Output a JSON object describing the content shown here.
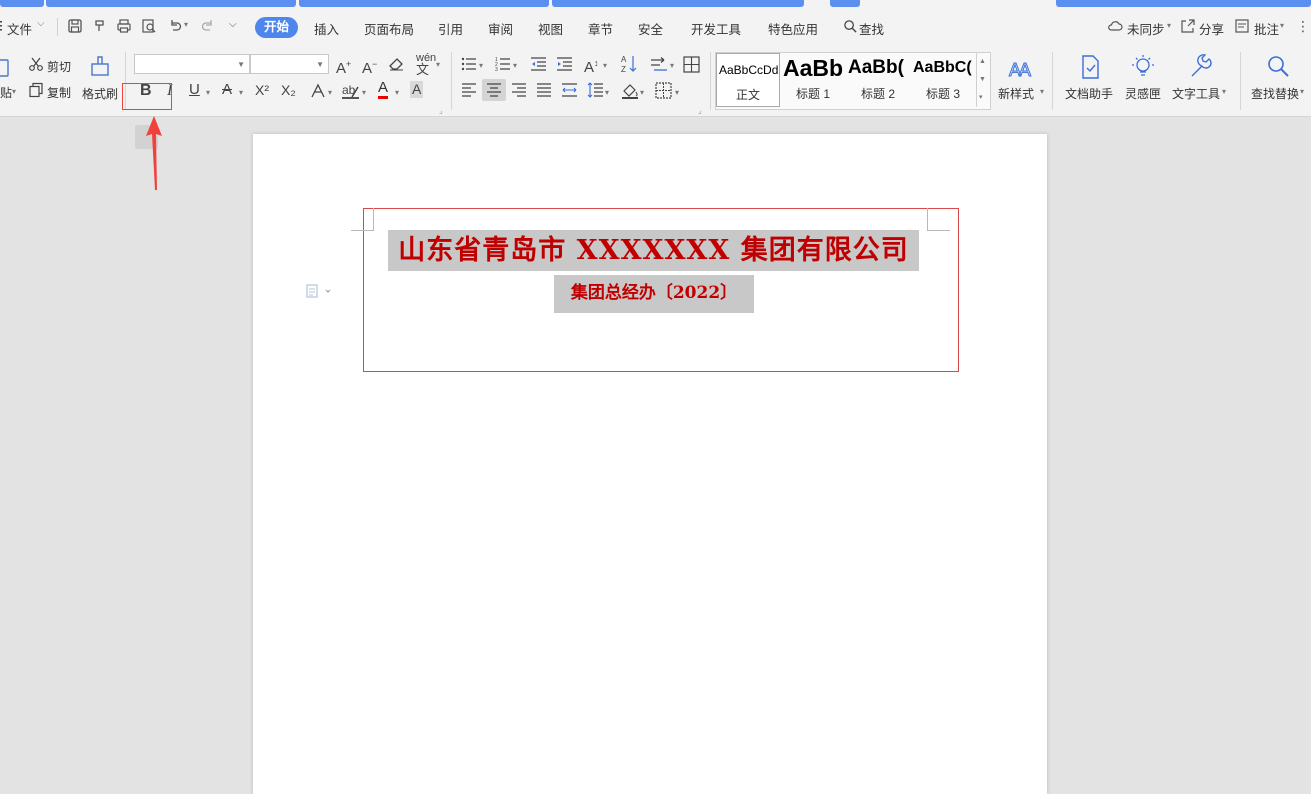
{
  "menubar": {
    "file": "文件",
    "items": [
      "开始",
      "插入",
      "页面布局",
      "引用",
      "审阅",
      "视图",
      "章节",
      "安全",
      "开发工具",
      "特色应用"
    ],
    "search": "查找",
    "sync": "未同步",
    "share": "分享",
    "comment": "批注"
  },
  "ribbon": {
    "cut": "剪切",
    "copy": "复制",
    "paste_partial": "贴",
    "format_painter": "格式刷",
    "font_name": "",
    "font_size": "",
    "bold": "B",
    "italic": "I",
    "underline": "U",
    "strike": "A",
    "superscript": "X²",
    "subscript": "X₂",
    "styles": [
      {
        "sample": "AaBbCcDd",
        "name": "正文"
      },
      {
        "sample": "AaBb",
        "name": "标题 1"
      },
      {
        "sample": "AaBb(",
        "name": "标题 2"
      },
      {
        "sample": "AaBbC(",
        "name": "标题 3"
      }
    ],
    "new_style": "新样式",
    "doc_assistant": "文档助手",
    "inspiration": "灵感匣",
    "text_tools": "文字工具",
    "find_replace": "查找替换"
  },
  "document": {
    "title": "山东省青岛市 XXXXXXX 集团有限公司",
    "subtitle": "集团总经办〔2022〕"
  },
  "colors": {
    "accent": "#4f86ec",
    "doc_red": "#c00000",
    "highlight_red": "#f0413b"
  }
}
